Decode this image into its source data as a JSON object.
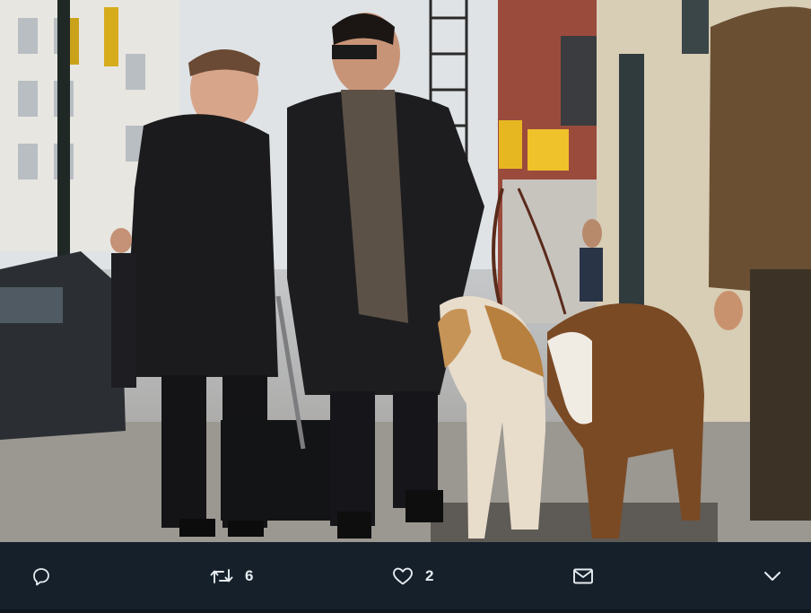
{
  "photo": {
    "icon": "photo",
    "subject": ""
  },
  "actions": {
    "reply": {
      "icon": "reply-icon"
    },
    "retweet": {
      "icon": "retweet-icon",
      "count": "6"
    },
    "like": {
      "icon": "heart-icon",
      "count": "2"
    },
    "share": {
      "icon": "envelope-icon"
    },
    "more": {
      "icon": "chevron-down-icon"
    }
  },
  "colors": {
    "bar_background": "#15202b",
    "icon_color": "#e6ecf0"
  }
}
